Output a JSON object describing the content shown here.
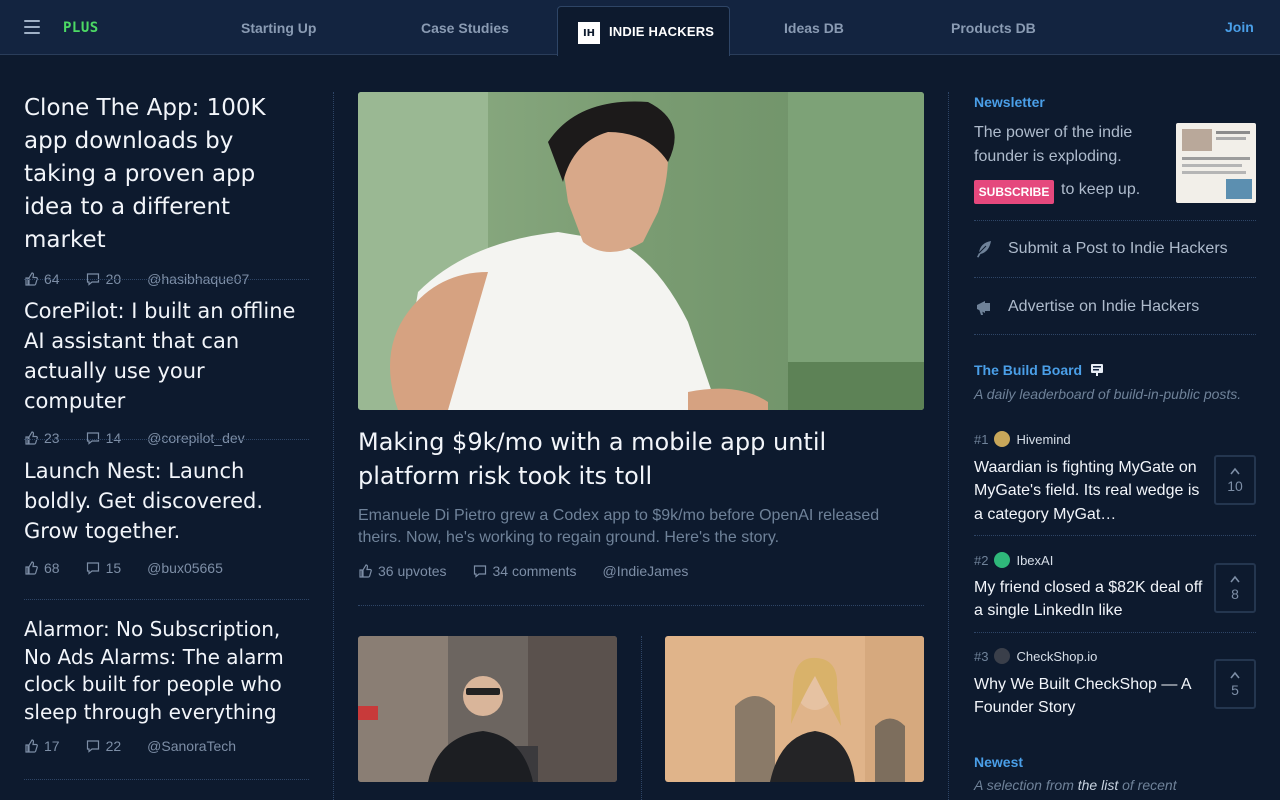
{
  "header": {
    "plus_label": "PLUS",
    "nav": [
      "Starting Up",
      "Case Studies",
      "INDIE HACKERS",
      "Ideas DB",
      "Products DB"
    ],
    "ih_badge": "IH",
    "join_label": "Join"
  },
  "left_posts": [
    {
      "title": "Clone The App: 100K app downloads by taking a proven app idea to a different market",
      "upvotes": "64",
      "comments": "20",
      "author": "@hasibhaque07"
    },
    {
      "title": "CorePilot: I built an offline AI assistant that can actually use your computer",
      "upvotes": "23",
      "comments": "14",
      "author": "@corepilot_dev"
    },
    {
      "title": "Launch Nest: Launch boldly. Get discovered. Grow together.",
      "upvotes": "68",
      "comments": "15",
      "author": "@bux05665"
    },
    {
      "title": "Alarmor: No Subscription, No Ads Alarms: The alarm clock built for people who sleep through everything",
      "upvotes": "17",
      "comments": "22",
      "author": "@SanoraTech"
    }
  ],
  "featured": {
    "title": "Making $9k/mo with a mobile app until platform risk took its toll",
    "description": "Emanuele Di Pietro grew a Codex app to $9k/mo before OpenAI released theirs. Now, he's working to regain ground. Here's the story.",
    "upvotes": "36 upvotes",
    "comments": "34 comments",
    "author": "@IndieJames"
  },
  "sidebar": {
    "newsletter": {
      "heading": "Newsletter",
      "text": "The power of the indie founder is exploding.",
      "subscribe_label": "SUBSCRIBE",
      "after_label": "to keep up."
    },
    "submit_label": "Submit a Post to Indie Hackers",
    "advertise_label": "Advertise on Indie Hackers",
    "build_board": {
      "heading": "The Build Board",
      "subtitle": "A daily leaderboard of build-in-public posts.",
      "items": [
        {
          "rank": "#1",
          "name": "Hivemind",
          "title": "Waardian is fighting MyGate on MyGate's field. Its real wedge is a category MyGat…",
          "votes": "10",
          "logo_color": "#c8a75a"
        },
        {
          "rank": "#2",
          "name": "IbexAI",
          "title": "My friend closed a $82K deal off a single LinkedIn like",
          "votes": "8",
          "logo_color": "#2fb87a"
        },
        {
          "rank": "#3",
          "name": "CheckShop.io",
          "title": "Why We Built CheckShop — A Founder Story",
          "votes": "5",
          "logo_color": "#3a3f4a"
        }
      ]
    },
    "newest": {
      "heading": "Newest",
      "subtitle_pre": "A selection from ",
      "subtitle_link": "the list",
      "subtitle_post": " of recent"
    }
  }
}
